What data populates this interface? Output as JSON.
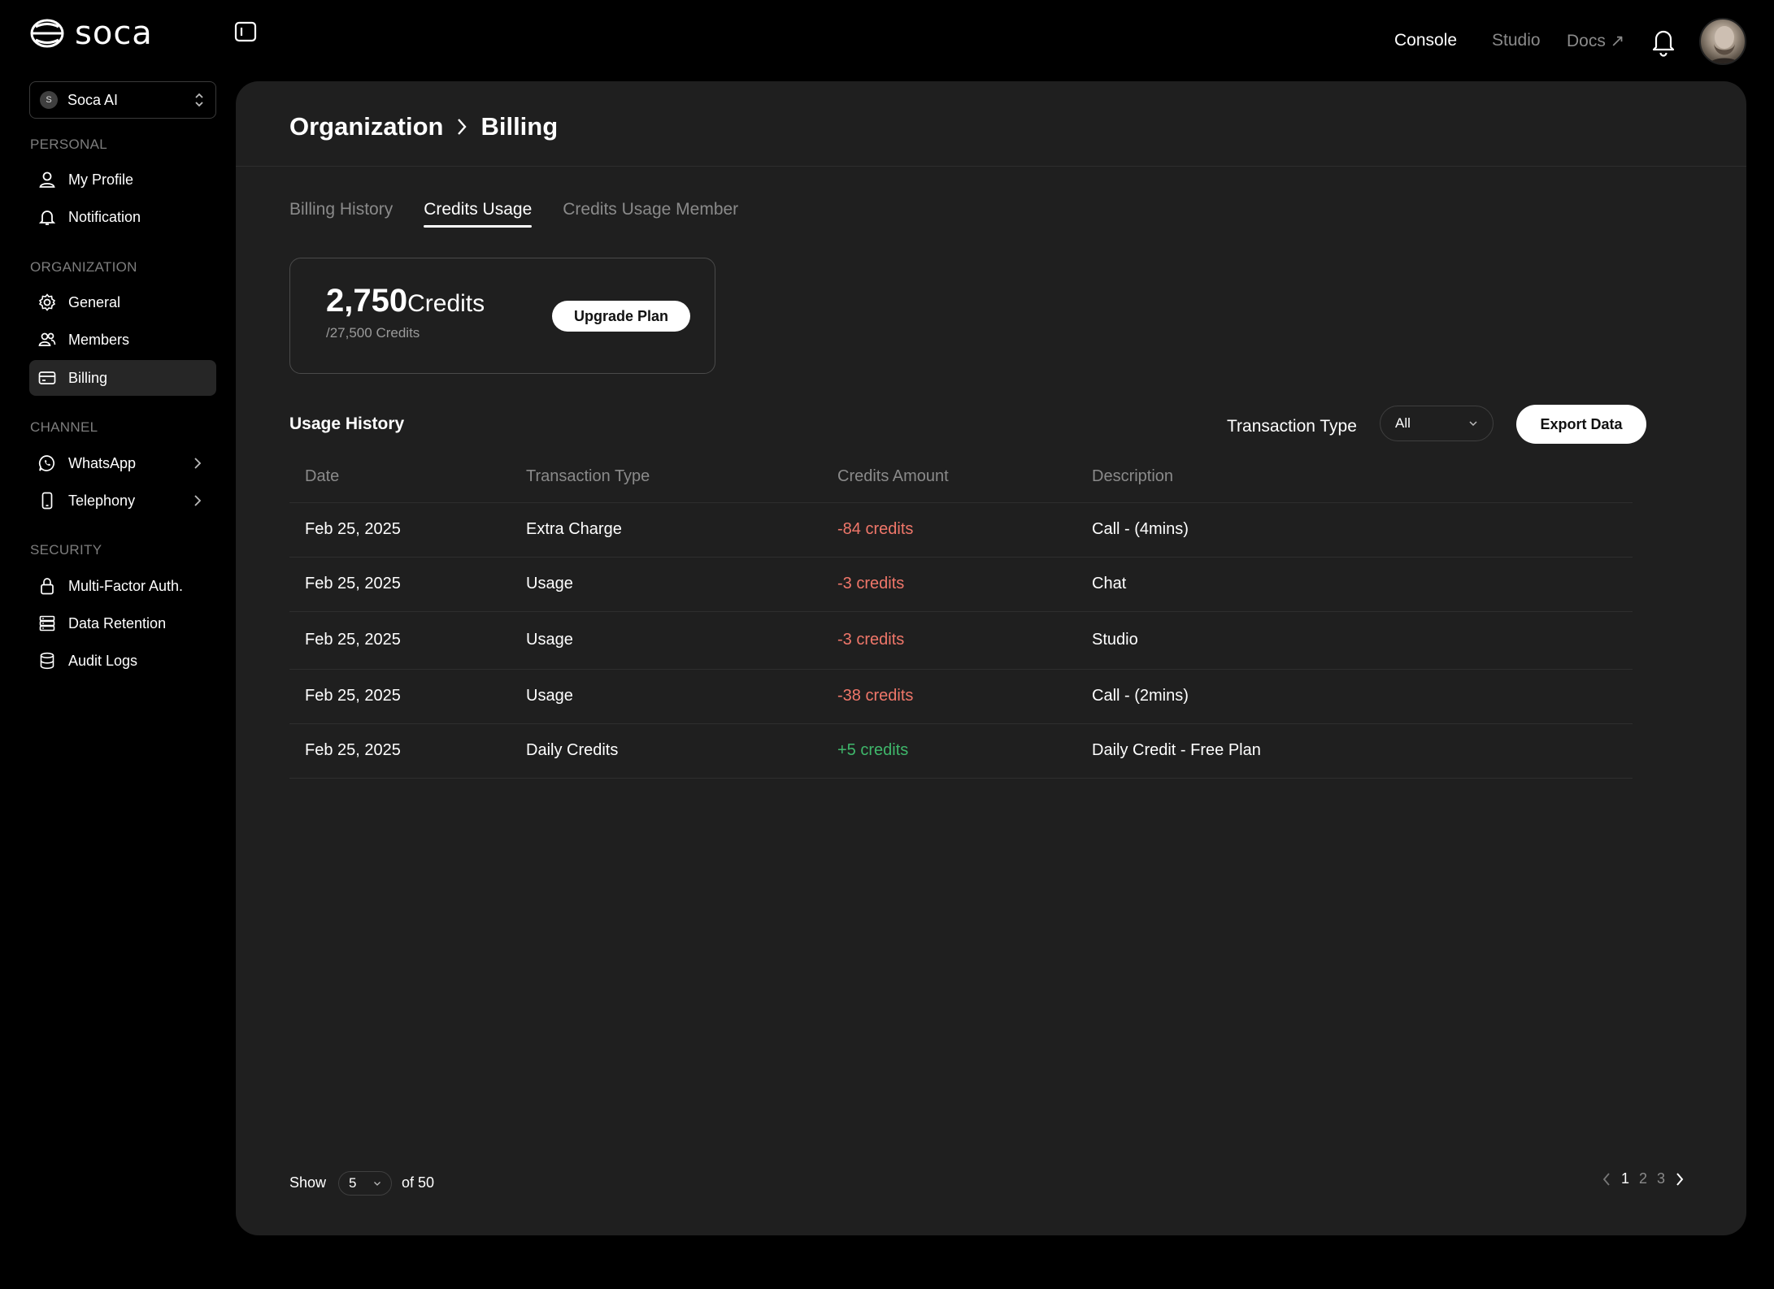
{
  "app": {
    "logo_text": "soca"
  },
  "org_selector": {
    "initial": "S",
    "name": "Soca AI"
  },
  "sidebar": {
    "sections": [
      {
        "label": "PERSONAL"
      },
      {
        "label": "ORGANIZATION"
      },
      {
        "label": "CHANNEL"
      },
      {
        "label": "SECURITY"
      }
    ],
    "items": [
      {
        "label": "My Profile",
        "icon": "user-icon"
      },
      {
        "label": "Notification",
        "icon": "bell-icon"
      },
      {
        "label": "General",
        "icon": "gear-icon"
      },
      {
        "label": "Members",
        "icon": "users-icon"
      },
      {
        "label": "Billing",
        "icon": "credit-card-icon",
        "active": true
      },
      {
        "label": "WhatsApp",
        "icon": "whatsapp-icon"
      },
      {
        "label": "Telephony",
        "icon": "phone-icon"
      },
      {
        "label": "Multi-Factor Auth.",
        "icon": "lock-icon"
      },
      {
        "label": "Data Retention",
        "icon": "server-icon"
      },
      {
        "label": "Audit Logs",
        "icon": "database-icon"
      }
    ]
  },
  "topnav": {
    "console": "Console",
    "studio": "Studio",
    "docs": "Docs ↗"
  },
  "breadcrumb": {
    "parent": "Organization",
    "current": "Billing"
  },
  "tabs": [
    {
      "label": "Billing History"
    },
    {
      "label": "Credits Usage",
      "active": true
    },
    {
      "label": "Credits Usage Member"
    }
  ],
  "credits": {
    "amount": "2,750",
    "unit": "Credits",
    "total": "/27,500 Credits",
    "upgrade_label": "Upgrade Plan"
  },
  "usage": {
    "title": "Usage History",
    "filter_label": "Transaction Type",
    "filter_value": "All",
    "export_label": "Export Data",
    "columns": [
      "Date",
      "Transaction Type",
      "Credits Amount",
      "Description"
    ],
    "rows": [
      {
        "date": "Feb 25, 2025",
        "type": "Extra Charge",
        "amount": "-84 credits",
        "description": "Call - (4mins)",
        "sign": "neg"
      },
      {
        "date": "Feb 25, 2025",
        "type": "Usage",
        "amount": "-3 credits",
        "description": "Chat",
        "sign": "neg"
      },
      {
        "date": "Feb 25, 2025",
        "type": "Usage",
        "amount": "-3 credits",
        "description": "Studio",
        "sign": "neg"
      },
      {
        "date": "Feb 25, 2025",
        "type": "Usage",
        "amount": "-38 credits",
        "description": "Call - (2mins)",
        "sign": "neg"
      },
      {
        "date": "Feb 25, 2025",
        "type": "Daily Credits",
        "amount": "+5 credits",
        "description": "Daily Credit - Free Plan",
        "sign": "pos"
      }
    ]
  },
  "pagination": {
    "show_label": "Show",
    "page_size": "5",
    "of_label": "of 50",
    "pages": [
      "1",
      "2",
      "3"
    ],
    "current_page": "1"
  },
  "colors": {
    "negative": "#f0776a",
    "positive": "#3fb76b",
    "panel": "#1f1f1f"
  }
}
